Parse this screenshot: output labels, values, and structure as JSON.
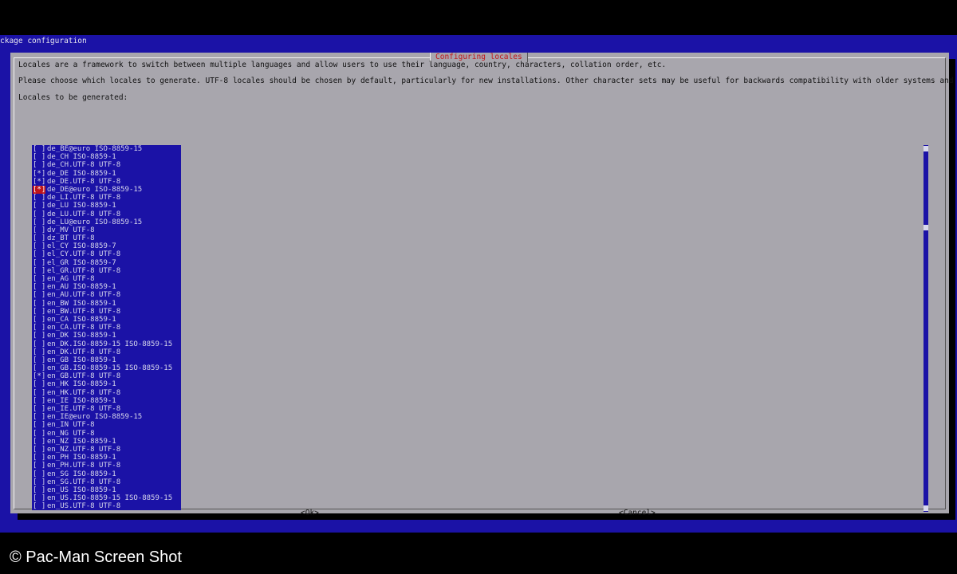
{
  "window": {
    "title": "ckage configuration",
    "dialog_title": "Configuring locales"
  },
  "dialog": {
    "intro": "Locales are a framework to switch between multiple languages and allow users to use their language, country, characters, collation order, etc.",
    "instruction": "Please choose which locales to generate. UTF-8 locales should be chosen by default, particularly for new installations. Other character sets may be useful for backwards compatibility with older systems and software.",
    "list_heading": "Locales to be generated:"
  },
  "locales": [
    {
      "label": "de_BE@euro ISO-8859-15",
      "checkbox": "[ ]"
    },
    {
      "label": "de_CH ISO-8859-1",
      "checkbox": "[ ]"
    },
    {
      "label": "de_CH.UTF-8 UTF-8",
      "checkbox": "[ ]"
    },
    {
      "label": "de_DE ISO-8859-1",
      "checkbox": "[*]"
    },
    {
      "label": "de_DE.UTF-8 UTF-8",
      "checkbox": "[*]"
    },
    {
      "label": "de_DE@euro ISO-8859-15",
      "checkbox": "[*]",
      "cursor": true
    },
    {
      "label": "de_LI.UTF-8 UTF-8",
      "checkbox": "[ ]"
    },
    {
      "label": "de_LU ISO-8859-1",
      "checkbox": "[ ]"
    },
    {
      "label": "de_LU.UTF-8 UTF-8",
      "checkbox": "[ ]"
    },
    {
      "label": "de_LU@euro ISO-8859-15",
      "checkbox": "[ ]"
    },
    {
      "label": "dv_MV UTF-8",
      "checkbox": "[ ]"
    },
    {
      "label": "dz_BT UTF-8",
      "checkbox": "[ ]"
    },
    {
      "label": "el_CY ISO-8859-7",
      "checkbox": "[ ]"
    },
    {
      "label": "el_CY.UTF-8 UTF-8",
      "checkbox": "[ ]"
    },
    {
      "label": "el_GR ISO-8859-7",
      "checkbox": "[ ]"
    },
    {
      "label": "el_GR.UTF-8 UTF-8",
      "checkbox": "[ ]"
    },
    {
      "label": "en_AG UTF-8",
      "checkbox": "[ ]"
    },
    {
      "label": "en_AU ISO-8859-1",
      "checkbox": "[ ]"
    },
    {
      "label": "en_AU.UTF-8 UTF-8",
      "checkbox": "[ ]"
    },
    {
      "label": "en_BW ISO-8859-1",
      "checkbox": "[ ]"
    },
    {
      "label": "en_BW.UTF-8 UTF-8",
      "checkbox": "[ ]"
    },
    {
      "label": "en_CA ISO-8859-1",
      "checkbox": "[ ]"
    },
    {
      "label": "en_CA.UTF-8 UTF-8",
      "checkbox": "[ ]"
    },
    {
      "label": "en_DK ISO-8859-1",
      "checkbox": "[ ]"
    },
    {
      "label": "en_DK.ISO-8859-15 ISO-8859-15",
      "checkbox": "[ ]"
    },
    {
      "label": "en_DK.UTF-8 UTF-8",
      "checkbox": "[ ]"
    },
    {
      "label": "en_GB ISO-8859-1",
      "checkbox": "[ ]"
    },
    {
      "label": "en_GB.ISO-8859-15 ISO-8859-15",
      "checkbox": "[ ]"
    },
    {
      "label": "en_GB.UTF-8 UTF-8",
      "checkbox": "[*]"
    },
    {
      "label": "en_HK ISO-8859-1",
      "checkbox": "[ ]"
    },
    {
      "label": "en_HK.UTF-8 UTF-8",
      "checkbox": "[ ]"
    },
    {
      "label": "en_IE ISO-8859-1",
      "checkbox": "[ ]"
    },
    {
      "label": "en_IE.UTF-8 UTF-8",
      "checkbox": "[ ]"
    },
    {
      "label": "en_IE@euro ISO-8859-15",
      "checkbox": "[ ]"
    },
    {
      "label": "en_IN UTF-8",
      "checkbox": "[ ]"
    },
    {
      "label": "en_NG UTF-8",
      "checkbox": "[ ]"
    },
    {
      "label": "en_NZ ISO-8859-1",
      "checkbox": "[ ]"
    },
    {
      "label": "en_NZ.UTF-8 UTF-8",
      "checkbox": "[ ]"
    },
    {
      "label": "en_PH ISO-8859-1",
      "checkbox": "[ ]"
    },
    {
      "label": "en_PH.UTF-8 UTF-8",
      "checkbox": "[ ]"
    },
    {
      "label": "en_SG ISO-8859-1",
      "checkbox": "[ ]"
    },
    {
      "label": "en_SG.UTF-8 UTF-8",
      "checkbox": "[ ]"
    },
    {
      "label": "en_US ISO-8859-1",
      "checkbox": "[ ]"
    },
    {
      "label": "en_US.ISO-8859-15 ISO-8859-15",
      "checkbox": "[ ]"
    },
    {
      "label": "en_US.UTF-8 UTF-8",
      "checkbox": "[ ]"
    }
  ],
  "scrollbar": {
    "top_arrow": "↑",
    "thumb": "■",
    "bottom_arrow": "↓"
  },
  "buttons": {
    "ok": "<Ok>",
    "cancel": "<Cancel>"
  },
  "watermark": "© Pac-Man Screen Shot",
  "colors": {
    "background": "#1b12a6",
    "dialog": "#a8a6ad",
    "title_red": "#c0151b",
    "list_text": "#d8d8ec"
  }
}
